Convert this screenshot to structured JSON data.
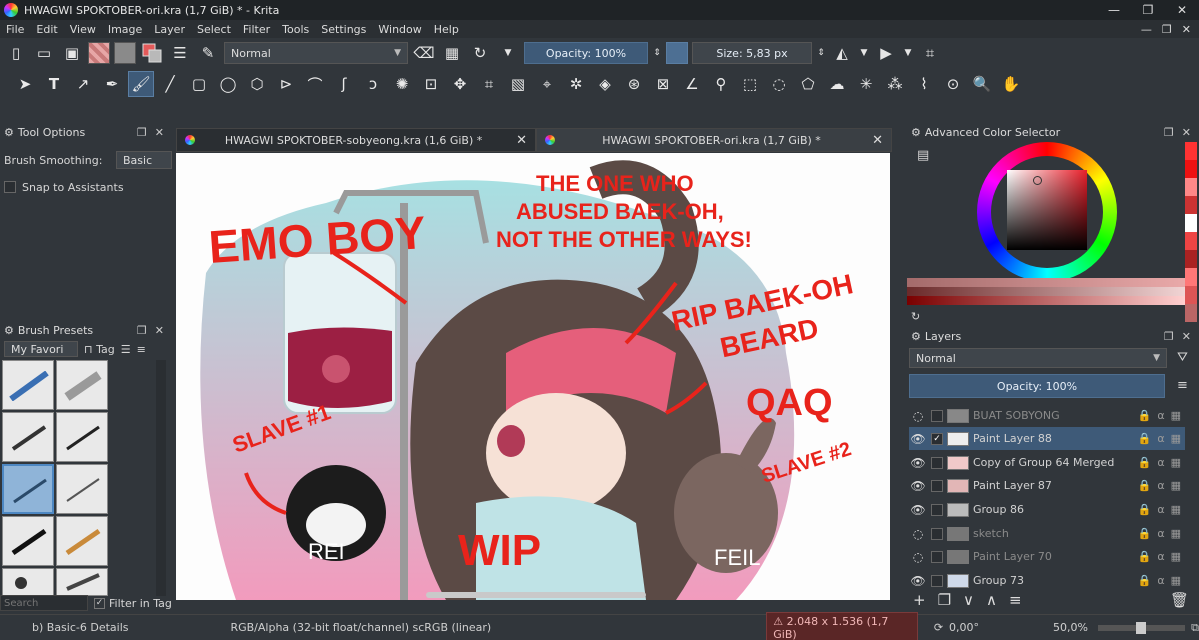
{
  "window": {
    "title": "HWAGWI SPOKTOBER-ori.kra (1,7 GiB) * - Krita",
    "controls": [
      "—",
      "❐",
      "✕"
    ]
  },
  "menu": [
    "File",
    "Edit",
    "View",
    "Image",
    "Layer",
    "Select",
    "Filter",
    "Tools",
    "Settings",
    "Window",
    "Help"
  ],
  "toolbar": {
    "blend_mode": "Normal",
    "opacity": "Opacity: 100%",
    "size": "Size: 5,83 px"
  },
  "tool_options": {
    "title": "Tool Options",
    "smoothing_label": "Brush Smoothing:",
    "smoothing_value": "Basic",
    "snap_label": "Snap to Assistants"
  },
  "brush_presets": {
    "title": "Brush Presets",
    "tag_filter": "My Favori",
    "tag_button": "Tag",
    "search_placeholder": "Search",
    "filter_in_tag": "Filter in Tag"
  },
  "tabs": [
    {
      "label": "HWAGWI SPOKTOBER-sobyeong.kra (1,6 GiB) *",
      "active": false
    },
    {
      "label": "HWAGWI SPOKTOBER-ori.kra (1,7 GiB) *",
      "active": true
    }
  ],
  "canvas_text": {
    "emo_boy": "EMO BOY",
    "abused": "THE ONE WHO ABUSED BAEK-OH, NOT THE OTHER WAYS!",
    "rip": "RIP BAEK-OH BEARD",
    "qaq": "QAQ",
    "slave1": "SLAVE #1",
    "slave2": "SLAVE #2",
    "wip": "WIP",
    "rei": "REI",
    "feil": "FEIL"
  },
  "color_selector": {
    "title": "Advanced Color Selector"
  },
  "layers": {
    "title": "Layers",
    "blend_mode": "Normal",
    "opacity": "Opacity:  100%",
    "items": [
      {
        "name": "BUAT SOBYONG",
        "visible": false,
        "selected": false
      },
      {
        "name": "Paint Layer 88",
        "visible": true,
        "selected": true
      },
      {
        "name": "Copy of Group 64 Merged",
        "visible": true,
        "selected": false
      },
      {
        "name": "Paint Layer 87",
        "visible": true,
        "selected": false
      },
      {
        "name": "Group 86",
        "visible": true,
        "selected": false
      },
      {
        "name": "sketch",
        "visible": false,
        "selected": false
      },
      {
        "name": "Paint Layer 70",
        "visible": false,
        "selected": false
      },
      {
        "name": "Group 73",
        "visible": true,
        "selected": false
      }
    ]
  },
  "status": {
    "preset": "b) Basic-6 Details",
    "color_space": "RGB/Alpha (32-bit float/channel)  scRGB (linear)",
    "dimensions": "2.048 x 1.536 (1,7 GiB)",
    "rotation": "0,00°",
    "zoom": "50,0%"
  },
  "colors": {
    "accent": "#3e5a78",
    "panel": "#31363b",
    "ink_red": "#e8231b"
  }
}
